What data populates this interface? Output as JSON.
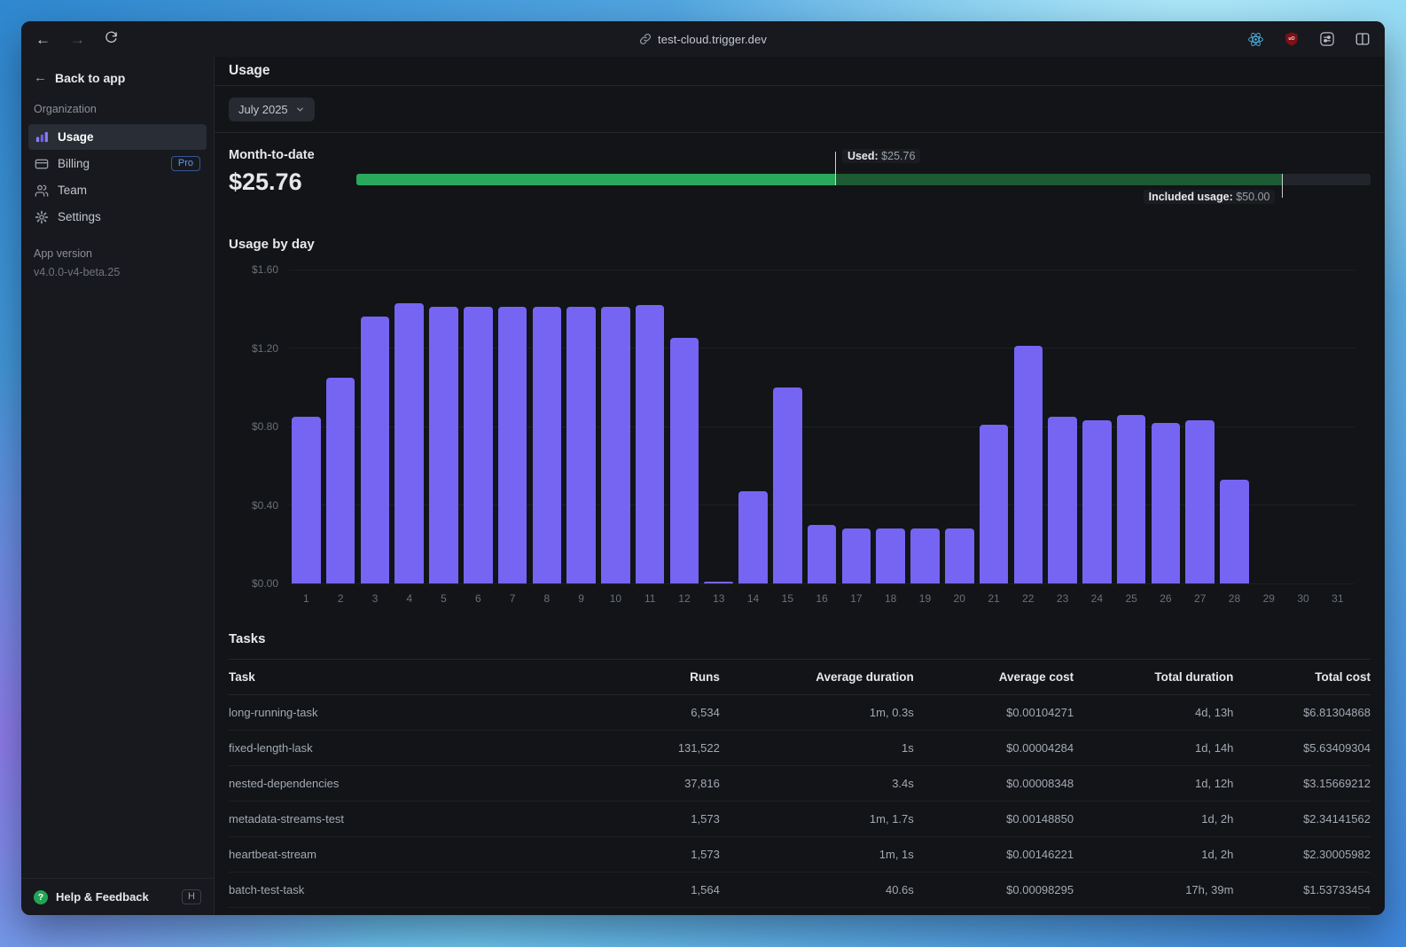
{
  "browser": {
    "url": "test-cloud.trigger.dev",
    "back_glyph": "←",
    "forward_glyph": "→",
    "extensions": [
      "react-devtools",
      "ublock-origin",
      "tune-extension",
      "split-view"
    ]
  },
  "sidebar": {
    "back_label": "Back to app",
    "section_label": "Organization",
    "items": [
      {
        "label": "Usage",
        "icon": "bar-chart-icon",
        "selected": true
      },
      {
        "label": "Billing",
        "icon": "credit-card-icon",
        "badge": "Pro"
      },
      {
        "label": "Team",
        "icon": "people-icon"
      },
      {
        "label": "Settings",
        "icon": "gear-icon"
      }
    ],
    "app_version_label": "App version",
    "app_version": "v4.0.0-v4-beta.25",
    "help_label": "Help & Feedback",
    "help_shortcut": "H"
  },
  "header": {
    "title": "Usage"
  },
  "filter": {
    "month": "July 2025"
  },
  "month_to_date": {
    "label": "Month-to-date",
    "value": "$25.76",
    "used_label": "Used:",
    "used_value": "$25.76",
    "included_label": "Included usage:",
    "included_value": "$50.00",
    "used_pct": 47.2,
    "included_pct": 91.3
  },
  "chart_data": {
    "type": "bar",
    "title": "Usage by day",
    "x": [
      1,
      2,
      3,
      4,
      5,
      6,
      7,
      8,
      9,
      10,
      11,
      12,
      13,
      14,
      15,
      16,
      17,
      18,
      19,
      20,
      21,
      22,
      23,
      24,
      25,
      26,
      27,
      28,
      29,
      30,
      31
    ],
    "values": [
      0.85,
      1.05,
      1.36,
      1.43,
      1.41,
      1.41,
      1.41,
      1.41,
      1.41,
      1.41,
      1.42,
      1.25,
      0.01,
      0.47,
      1.0,
      0.3,
      0.28,
      0.28,
      0.28,
      0.28,
      0.81,
      1.21,
      0.85,
      0.83,
      0.86,
      0.82,
      0.83,
      0.53,
      0,
      0,
      0
    ],
    "ylim": [
      0,
      1.6
    ],
    "yticks": [
      "$0.00",
      "$0.40",
      "$0.80",
      "$1.20",
      "$1.60"
    ],
    "bar_color": "#7565F2",
    "grid": true,
    "legend": "none"
  },
  "tasks": {
    "title": "Tasks",
    "headers": [
      "Task",
      "Runs",
      "Average duration",
      "Average cost",
      "Total duration",
      "Total cost"
    ],
    "rows": [
      [
        "long-running-task",
        "6,534",
        "1m, 0.3s",
        "$0.00104271",
        "4d, 13h",
        "$6.81304868"
      ],
      [
        "fixed-length-lask",
        "131,522",
        "1s",
        "$0.00004284",
        "1d, 14h",
        "$5.63409304"
      ],
      [
        "nested-dependencies",
        "37,816",
        "3.4s",
        "$0.00008348",
        "1d, 12h",
        "$3.15669212"
      ],
      [
        "metadata-streams-test",
        "1,573",
        "1m, 1.7s",
        "$0.00148850",
        "1d, 2h",
        "$2.34141562"
      ],
      [
        "heartbeat-stream",
        "1,573",
        "1m, 1s",
        "$0.00146221",
        "1d, 2h",
        "$2.30005982"
      ],
      [
        "batch-test-task",
        "1,564",
        "40.6s",
        "$0.00098295",
        "17h, 39m",
        "$1.53733454"
      ]
    ]
  },
  "colors": {
    "accent_purple": "#7565F2",
    "used_green": "#28A95C",
    "included_green": "#1C5B33",
    "pro_blue": "#5B9BF8",
    "help_green": "#23A455"
  }
}
